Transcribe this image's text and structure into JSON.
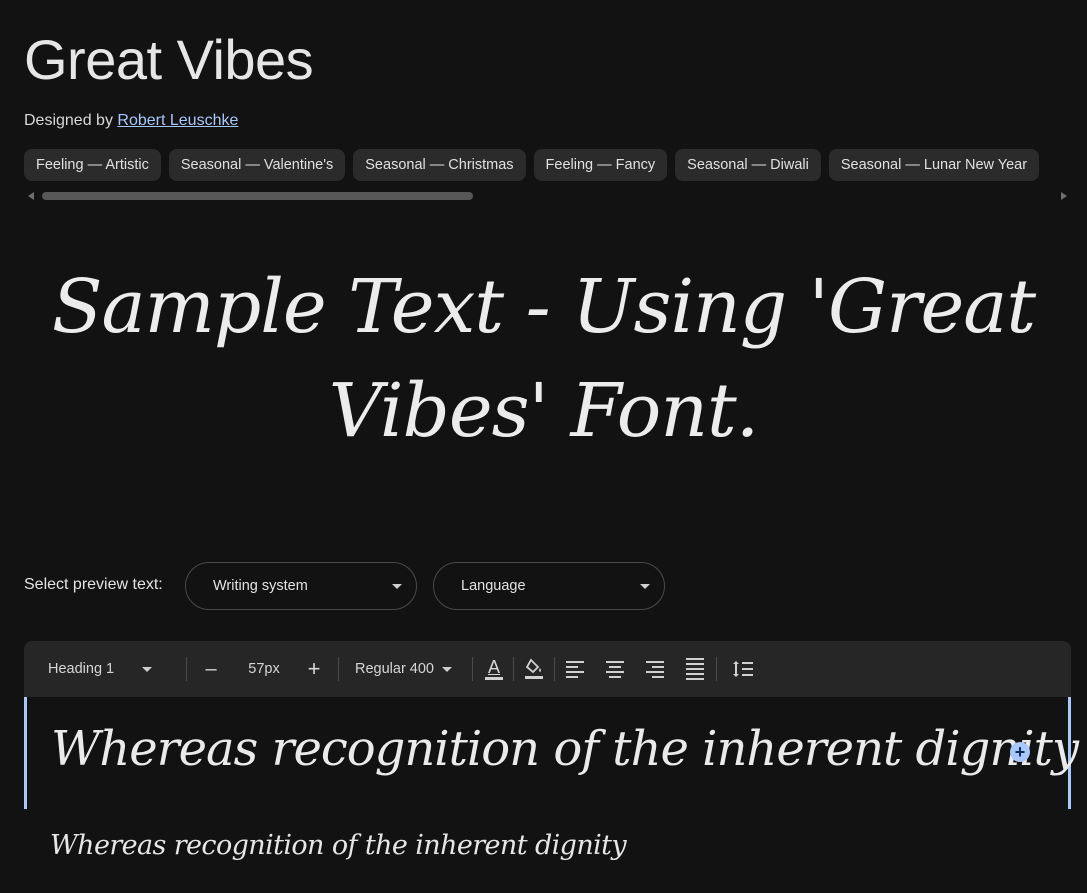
{
  "font": {
    "title": "Great Vibes",
    "designed_by_label": "Designed by",
    "designer_name": "Robert Leuschke"
  },
  "tags": [
    "Feeling — Artistic",
    "Seasonal — Valentine's",
    "Seasonal — Christmas",
    "Feeling — Fancy",
    "Seasonal — Diwali",
    "Seasonal — Lunar New Year"
  ],
  "hero_sample": "Sample Text - Using 'Great Vibes' Font.",
  "preview": {
    "label": "Select preview text:",
    "writing_system": "Writing system",
    "language": "Language"
  },
  "toolbar": {
    "style": "Heading 1",
    "decrease": "–",
    "size": "57px",
    "increase": "+",
    "weight": "Regular 400",
    "text_color_glyph": "A"
  },
  "editor": {
    "heading_text": "Whereas recognition of the inherent dignity",
    "body_text": "Whereas recognition of the inherent dignity"
  },
  "colors": {
    "background": "#121212",
    "accent": "#a8c7fa",
    "chip": "#2b2b2b",
    "toolbar": "#262626"
  },
  "icons": [
    "chevron-down-icon",
    "text-color-icon",
    "highlight-color-icon",
    "align-left-icon",
    "align-center-icon",
    "align-right-icon",
    "align-justify-icon",
    "line-spacing-icon",
    "add-icon"
  ]
}
